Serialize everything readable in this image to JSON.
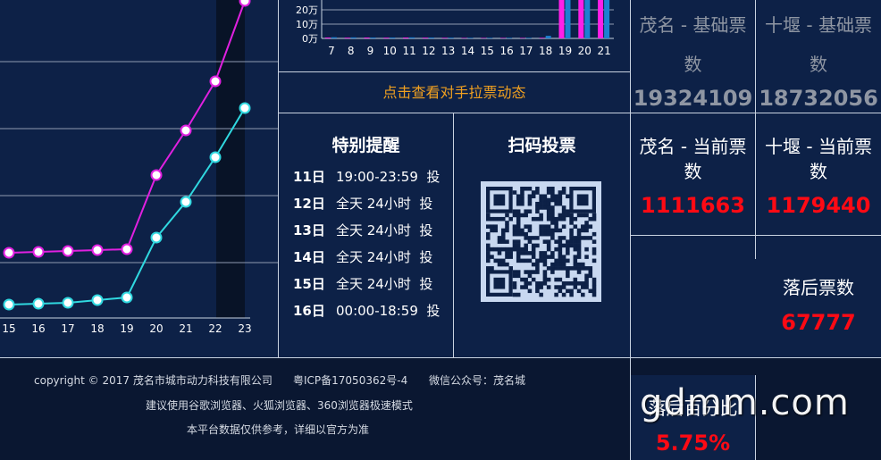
{
  "line_chart": {
    "x_ticks": [
      "15",
      "16",
      "17",
      "18",
      "19",
      "20",
      "21",
      "22",
      "23"
    ]
  },
  "bar_chart": {
    "y_ticks": [
      "20万",
      "10万",
      "0万"
    ],
    "x_ticks": [
      "7",
      "8",
      "9",
      "10",
      "11",
      "12",
      "13",
      "14",
      "15",
      "16",
      "17",
      "18",
      "19",
      "20",
      "21"
    ]
  },
  "chart_data": [
    {
      "type": "line",
      "x": [
        15,
        16,
        17,
        18,
        19,
        20,
        21,
        22,
        23
      ],
      "series": [
        {
          "color": "#e020e0",
          "values": [
            0.58,
            0.59,
            0.6,
            0.61,
            0.62,
            1.45,
            1.95,
            2.5,
            3.4
          ]
        },
        {
          "color": "#30d8e0",
          "values": [
            0.0,
            0.01,
            0.02,
            0.05,
            0.08,
            0.75,
            1.15,
            1.65,
            2.2
          ]
        }
      ],
      "xlim": [
        15,
        23
      ],
      "grid": true,
      "highlight_column": 22
    },
    {
      "type": "bar",
      "categories": [
        "7",
        "8",
        "9",
        "10",
        "11",
        "12",
        "13",
        "14",
        "15",
        "16",
        "17",
        "18",
        "19",
        "20",
        "21"
      ],
      "series": [
        {
          "color": "#ff1fe9",
          "values": [
            0.6,
            0.5,
            0.6,
            0.5,
            0.6,
            0.5,
            0.4,
            0.3,
            0.3,
            0.3,
            0.3,
            0.4,
            60,
            60,
            60
          ]
        },
        {
          "color": "#1f7fd1",
          "values": [
            0.8,
            0.7,
            0.6,
            0.6,
            0.7,
            0.6,
            0.5,
            0.4,
            0.4,
            0.4,
            0.4,
            1.8,
            60,
            60,
            60
          ]
        }
      ],
      "y_unit": "万",
      "ylim": [
        0,
        30
      ]
    }
  ],
  "pull_votes_link": "点击查看对手拉票动态",
  "reminder": {
    "title": "特别提醒",
    "rows": [
      {
        "day": "11日",
        "time": "19:00-23:59",
        "action": "投"
      },
      {
        "day": "12日",
        "time": "全天 24小时",
        "action": "投"
      },
      {
        "day": "13日",
        "time": "全天 24小时",
        "action": "投"
      },
      {
        "day": "14日",
        "time": "全天 24小时",
        "action": "投"
      },
      {
        "day": "15日",
        "time": "全天 24小时",
        "action": "投"
      },
      {
        "day": "16日",
        "time": "00:00-18:59",
        "action": "投"
      }
    ]
  },
  "qr": {
    "title": "扫码投票"
  },
  "stats": {
    "maoming_base": {
      "label_line1": "茂名 - 基础票",
      "label_line2": "数",
      "value": "19324109"
    },
    "shiyan_base": {
      "label_line1": "十堰 - 基础票",
      "label_line2": "数",
      "value": "18732056"
    },
    "maoming_current": {
      "label_line1": "茂名 - 当前票",
      "label_line2": "数",
      "value": "1111663"
    },
    "shiyan_current": {
      "label_line1": "十堰 - 当前票",
      "label_line2": "数",
      "value": "1179440"
    },
    "behind": {
      "label": "落后票数",
      "value": "67777"
    },
    "behind_pct": {
      "label": "落后百分比",
      "value": "5.75%"
    }
  },
  "colors": {
    "background": "#0b1a33",
    "panel": "#0d2147",
    "red": "#ff0a14",
    "orange": "#f0a020",
    "grey": "#8f96a3"
  },
  "footer": {
    "copyright": "copyright © 2017  茂名市城市动力科技有限公司",
    "icp": "粤ICP备17050362号-4",
    "wechat": "微信公众号：茂名城",
    "browser_tip": "建议使用谷歌浏览器、火狐浏览器、360浏览器极速模式",
    "disclaimer": "本平台数据仅供参考，详细以官方为准"
  },
  "watermark": "gdmm.com"
}
